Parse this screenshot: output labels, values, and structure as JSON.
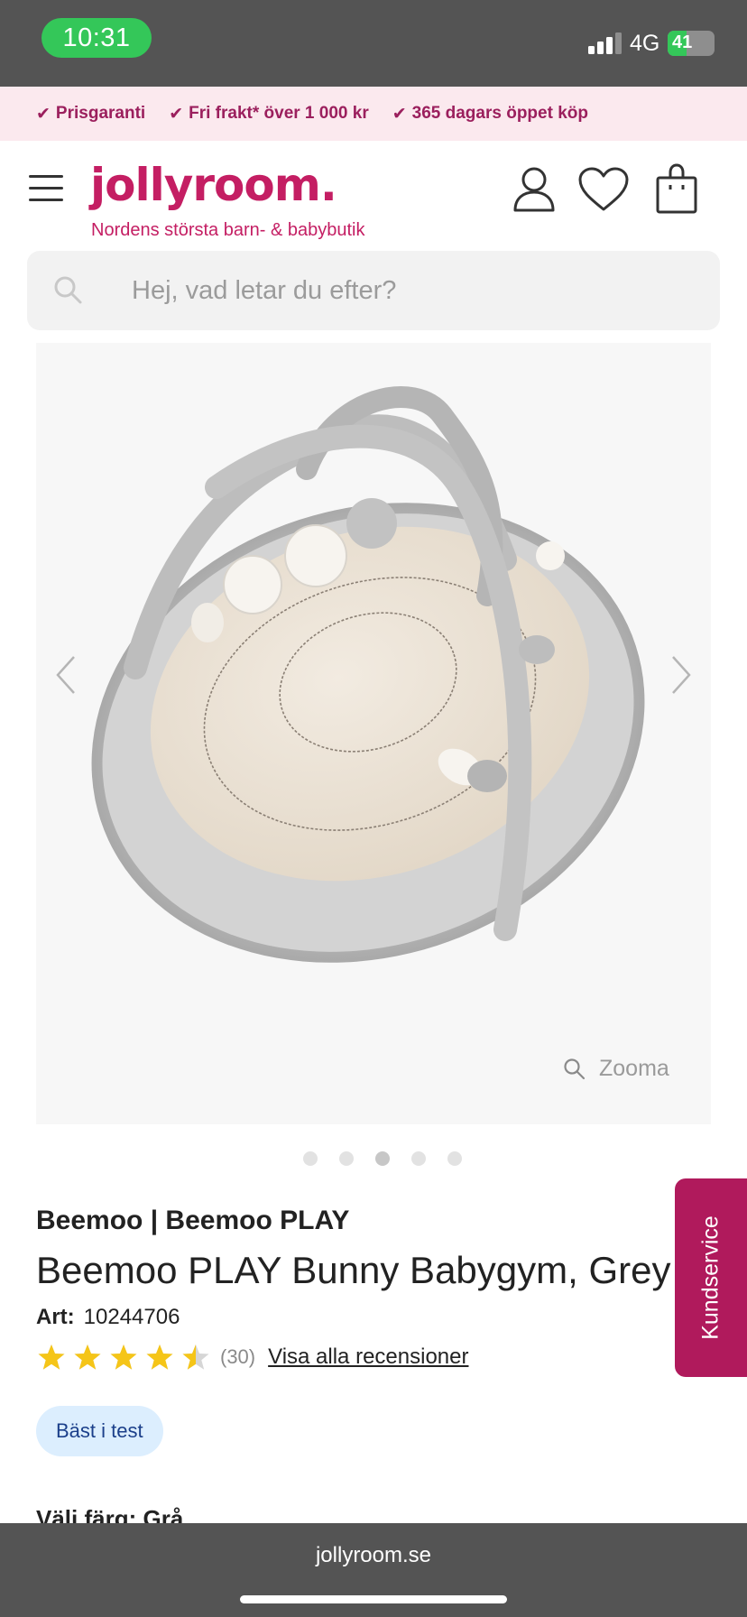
{
  "status_bar": {
    "time": "10:31",
    "network": "4G",
    "battery": "41",
    "battery_level": 0.41,
    "signal_bars": 3
  },
  "promo": {
    "items": [
      {
        "label": "Prisgaranti"
      },
      {
        "label": "Fri frakt* över 1 000 kr"
      },
      {
        "label": "365 dagars öppet köp"
      }
    ]
  },
  "header": {
    "logo": "jollyroom.",
    "tagline": "Nordens största barn- & babybutik",
    "icons": [
      "menu-icon",
      "account-icon",
      "heart-icon",
      "shopping-bag-icon"
    ]
  },
  "search": {
    "placeholder": "Hej, vad letar du efter?"
  },
  "gallery": {
    "zoom_label": "Zooma",
    "image_count": 5,
    "active_index": 2
  },
  "product": {
    "brand": "Beemoo | Beemoo PLAY",
    "title": "Beemoo PLAY Bunny Babygym, Grey",
    "art_label": "Art:",
    "art_number": "10244706",
    "rating": 4.5,
    "rating_max": 5,
    "review_count": "(30)",
    "reviews_link": "Visa alla recensioner",
    "badge": "Bäst i test",
    "color_label": "Välj färg: Grå"
  },
  "support": {
    "label": "Kundservice"
  },
  "browser": {
    "url": "jollyroom.se"
  },
  "colors": {
    "brand": "#c41e63",
    "promo_bg": "#fbe9ee",
    "promo_text": "#9b1f5d",
    "badge_bg": "#dceefe",
    "star": "#f5c518",
    "status_green": "#34c759"
  }
}
